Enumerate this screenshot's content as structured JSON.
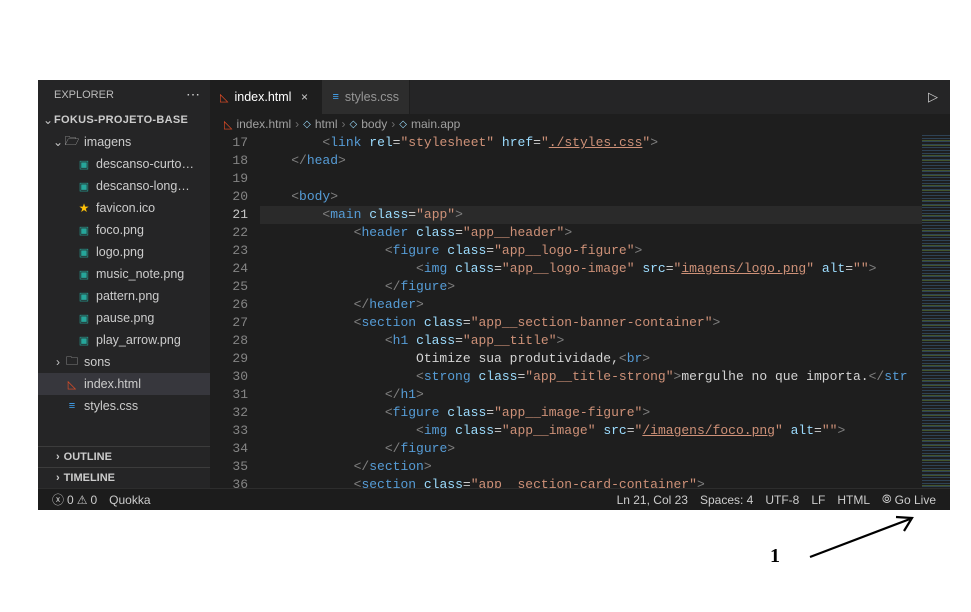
{
  "sidebar": {
    "title": "EXPLORER",
    "project": "FOKUS-PROJETO-BASE",
    "folders": {
      "imagens": "imagens",
      "sons": "sons"
    },
    "files": {
      "descanso_curto": "descanso-curto…",
      "descanso_long": "descanso-long…",
      "favicon": "favicon.ico",
      "foco": "foco.png",
      "logo": "logo.png",
      "music_note": "music_note.png",
      "pattern": "pattern.png",
      "pause": "pause.png",
      "play_arrow": "play_arrow.png",
      "index": "index.html",
      "styles": "styles.css"
    },
    "sections": {
      "outline": "OUTLINE",
      "timeline": "TIMELINE"
    }
  },
  "tabs": {
    "index": "index.html",
    "styles": "styles.css"
  },
  "breadcrumbs": {
    "file": "index.html",
    "b1": "html",
    "b2": "body",
    "b3": "main.app"
  },
  "code": {
    "lines": [
      {
        "n": 17,
        "html": "        <span class='t-bracket'>&lt;</span><span class='t-tag'>link</span> <span class='t-attr'>rel</span>=<span class='t-str'>\"stylesheet\"</span> <span class='t-attr'>href</span>=<span class='t-str'>\"</span><span class='t-url'>./styles.css</span><span class='t-str'>\"</span><span class='t-bracket'>&gt;</span>"
      },
      {
        "n": 18,
        "html": "    <span class='t-bracket'>&lt;/</span><span class='t-tag'>head</span><span class='t-bracket'>&gt;</span>"
      },
      {
        "n": 19,
        "html": ""
      },
      {
        "n": 20,
        "html": "    <span class='t-bracket'>&lt;</span><span class='t-tag'>body</span><span class='t-bracket'>&gt;</span>"
      },
      {
        "n": 21,
        "html": "        <span class='t-bracket'>&lt;</span><span class='t-tag'>main</span> <span class='t-attr'>class</span>=<span class='t-str'>\"app\"</span><span class='t-bracket'>&gt;</span>",
        "current": true,
        "bp": true
      },
      {
        "n": 22,
        "html": "            <span class='t-bracket'>&lt;</span><span class='t-tag'>header</span> <span class='t-attr'>class</span>=<span class='t-str'>\"app__header\"</span><span class='t-bracket'>&gt;</span>"
      },
      {
        "n": 23,
        "html": "                <span class='t-bracket'>&lt;</span><span class='t-tag'>figure</span> <span class='t-attr'>class</span>=<span class='t-str'>\"app__logo-figure\"</span><span class='t-bracket'>&gt;</span>"
      },
      {
        "n": 24,
        "html": "                    <span class='t-bracket'>&lt;</span><span class='t-tag'>img</span> <span class='t-attr'>class</span>=<span class='t-str'>\"app__logo-image\"</span> <span class='t-attr'>src</span>=<span class='t-str'>\"</span><span class='t-url'>imagens/logo.png</span><span class='t-str'>\"</span> <span class='t-attr'>alt</span>=<span class='t-str'>\"\"</span><span class='t-bracket'>&gt;</span>"
      },
      {
        "n": 25,
        "html": "                <span class='t-bracket'>&lt;/</span><span class='t-tag'>figure</span><span class='t-bracket'>&gt;</span>"
      },
      {
        "n": 26,
        "html": "            <span class='t-bracket'>&lt;/</span><span class='t-tag'>header</span><span class='t-bracket'>&gt;</span>"
      },
      {
        "n": 27,
        "html": "            <span class='t-bracket'>&lt;</span><span class='t-tag'>section</span> <span class='t-attr'>class</span>=<span class='t-str'>\"app__section-banner-container\"</span><span class='t-bracket'>&gt;</span>"
      },
      {
        "n": 28,
        "html": "                <span class='t-bracket'>&lt;</span><span class='t-tag'>h1</span> <span class='t-attr'>class</span>=<span class='t-str'>\"app__title\"</span><span class='t-bracket'>&gt;</span>"
      },
      {
        "n": 29,
        "html": "                    <span class='t-text'>Otimize sua produtividade,</span><span class='t-bracket'>&lt;</span><span class='t-tag'>br</span><span class='t-bracket'>&gt;</span>"
      },
      {
        "n": 30,
        "html": "                    <span class='t-bracket'>&lt;</span><span class='t-tag'>strong</span> <span class='t-attr'>class</span>=<span class='t-str'>\"app__title-strong\"</span><span class='t-bracket'>&gt;</span><span class='t-text'>mergulhe no que importa.</span><span class='t-bracket'>&lt;/</span><span class='t-tag'>str</span>"
      },
      {
        "n": 31,
        "html": "                <span class='t-bracket'>&lt;/</span><span class='t-tag'>h1</span><span class='t-bracket'>&gt;</span>"
      },
      {
        "n": 32,
        "html": "                <span class='t-bracket'>&lt;</span><span class='t-tag'>figure</span> <span class='t-attr'>class</span>=<span class='t-str'>\"app__image-figure\"</span><span class='t-bracket'>&gt;</span>"
      },
      {
        "n": 33,
        "html": "                    <span class='t-bracket'>&lt;</span><span class='t-tag'>img</span> <span class='t-attr'>class</span>=<span class='t-str'>\"app__image\"</span> <span class='t-attr'>src</span>=<span class='t-str'>\"</span><span class='t-url'>/imagens/foco.png</span><span class='t-str'>\"</span> <span class='t-attr'>alt</span>=<span class='t-str'>\"\"</span><span class='t-bracket'>&gt;</span>"
      },
      {
        "n": 34,
        "html": "                <span class='t-bracket'>&lt;/</span><span class='t-tag'>figure</span><span class='t-bracket'>&gt;</span>"
      },
      {
        "n": 35,
        "html": "            <span class='t-bracket'>&lt;/</span><span class='t-tag'>section</span><span class='t-bracket'>&gt;</span>"
      },
      {
        "n": 36,
        "html": "            <span class='t-bracket'>&lt;</span><span class='t-tag'>section</span> <span class='t-attr'>class</span>=<span class='t-str'>\"app__section-card-container\"</span><span class='t-bracket'>&gt;</span>"
      }
    ]
  },
  "status": {
    "errors": "0",
    "warnings": "0",
    "quokka": "Quokka",
    "cursor": "Ln 21, Col 23",
    "spaces": "Spaces: 4",
    "encoding": "UTF-8",
    "eol": "LF",
    "lang": "HTML",
    "golive": "Go Live"
  },
  "annotation": "1"
}
